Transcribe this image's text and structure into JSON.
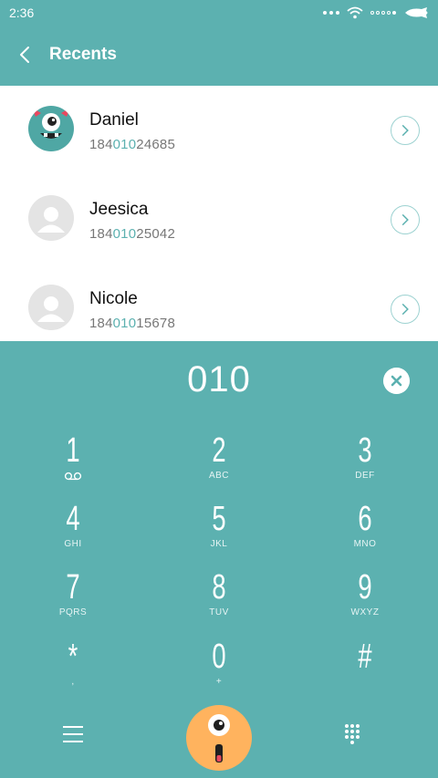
{
  "status": {
    "time": "2:36"
  },
  "header": {
    "title": "Recents"
  },
  "contacts": [
    {
      "name": "Daniel",
      "num_pre": "184",
      "num_hl": "010",
      "num_post": "24685",
      "avatar": "monster-avatar"
    },
    {
      "name": "Jeesica",
      "num_pre": "184",
      "num_hl": "010",
      "num_post": "25042",
      "avatar": "person-placeholder"
    },
    {
      "name": "Nicole",
      "num_pre": "184",
      "num_hl": "010",
      "num_post": "15678",
      "avatar": "person-placeholder"
    }
  ],
  "dialer": {
    "input": "010",
    "keys": [
      {
        "digit": "1",
        "letters": ""
      },
      {
        "digit": "2",
        "letters": "ABC"
      },
      {
        "digit": "3",
        "letters": "DEF"
      },
      {
        "digit": "4",
        "letters": "GHI"
      },
      {
        "digit": "5",
        "letters": "JKL"
      },
      {
        "digit": "6",
        "letters": "MNO"
      },
      {
        "digit": "7",
        "letters": "PQRS"
      },
      {
        "digit": "8",
        "letters": "TUV"
      },
      {
        "digit": "9",
        "letters": "WXYZ"
      },
      {
        "digit": "*",
        "letters": ","
      },
      {
        "digit": "0",
        "letters": "+"
      },
      {
        "digit": "#",
        "letters": ""
      }
    ]
  },
  "colors": {
    "accent": "#5cb1b0",
    "call": "#ffb35e",
    "monster": "#4fa7a4"
  }
}
